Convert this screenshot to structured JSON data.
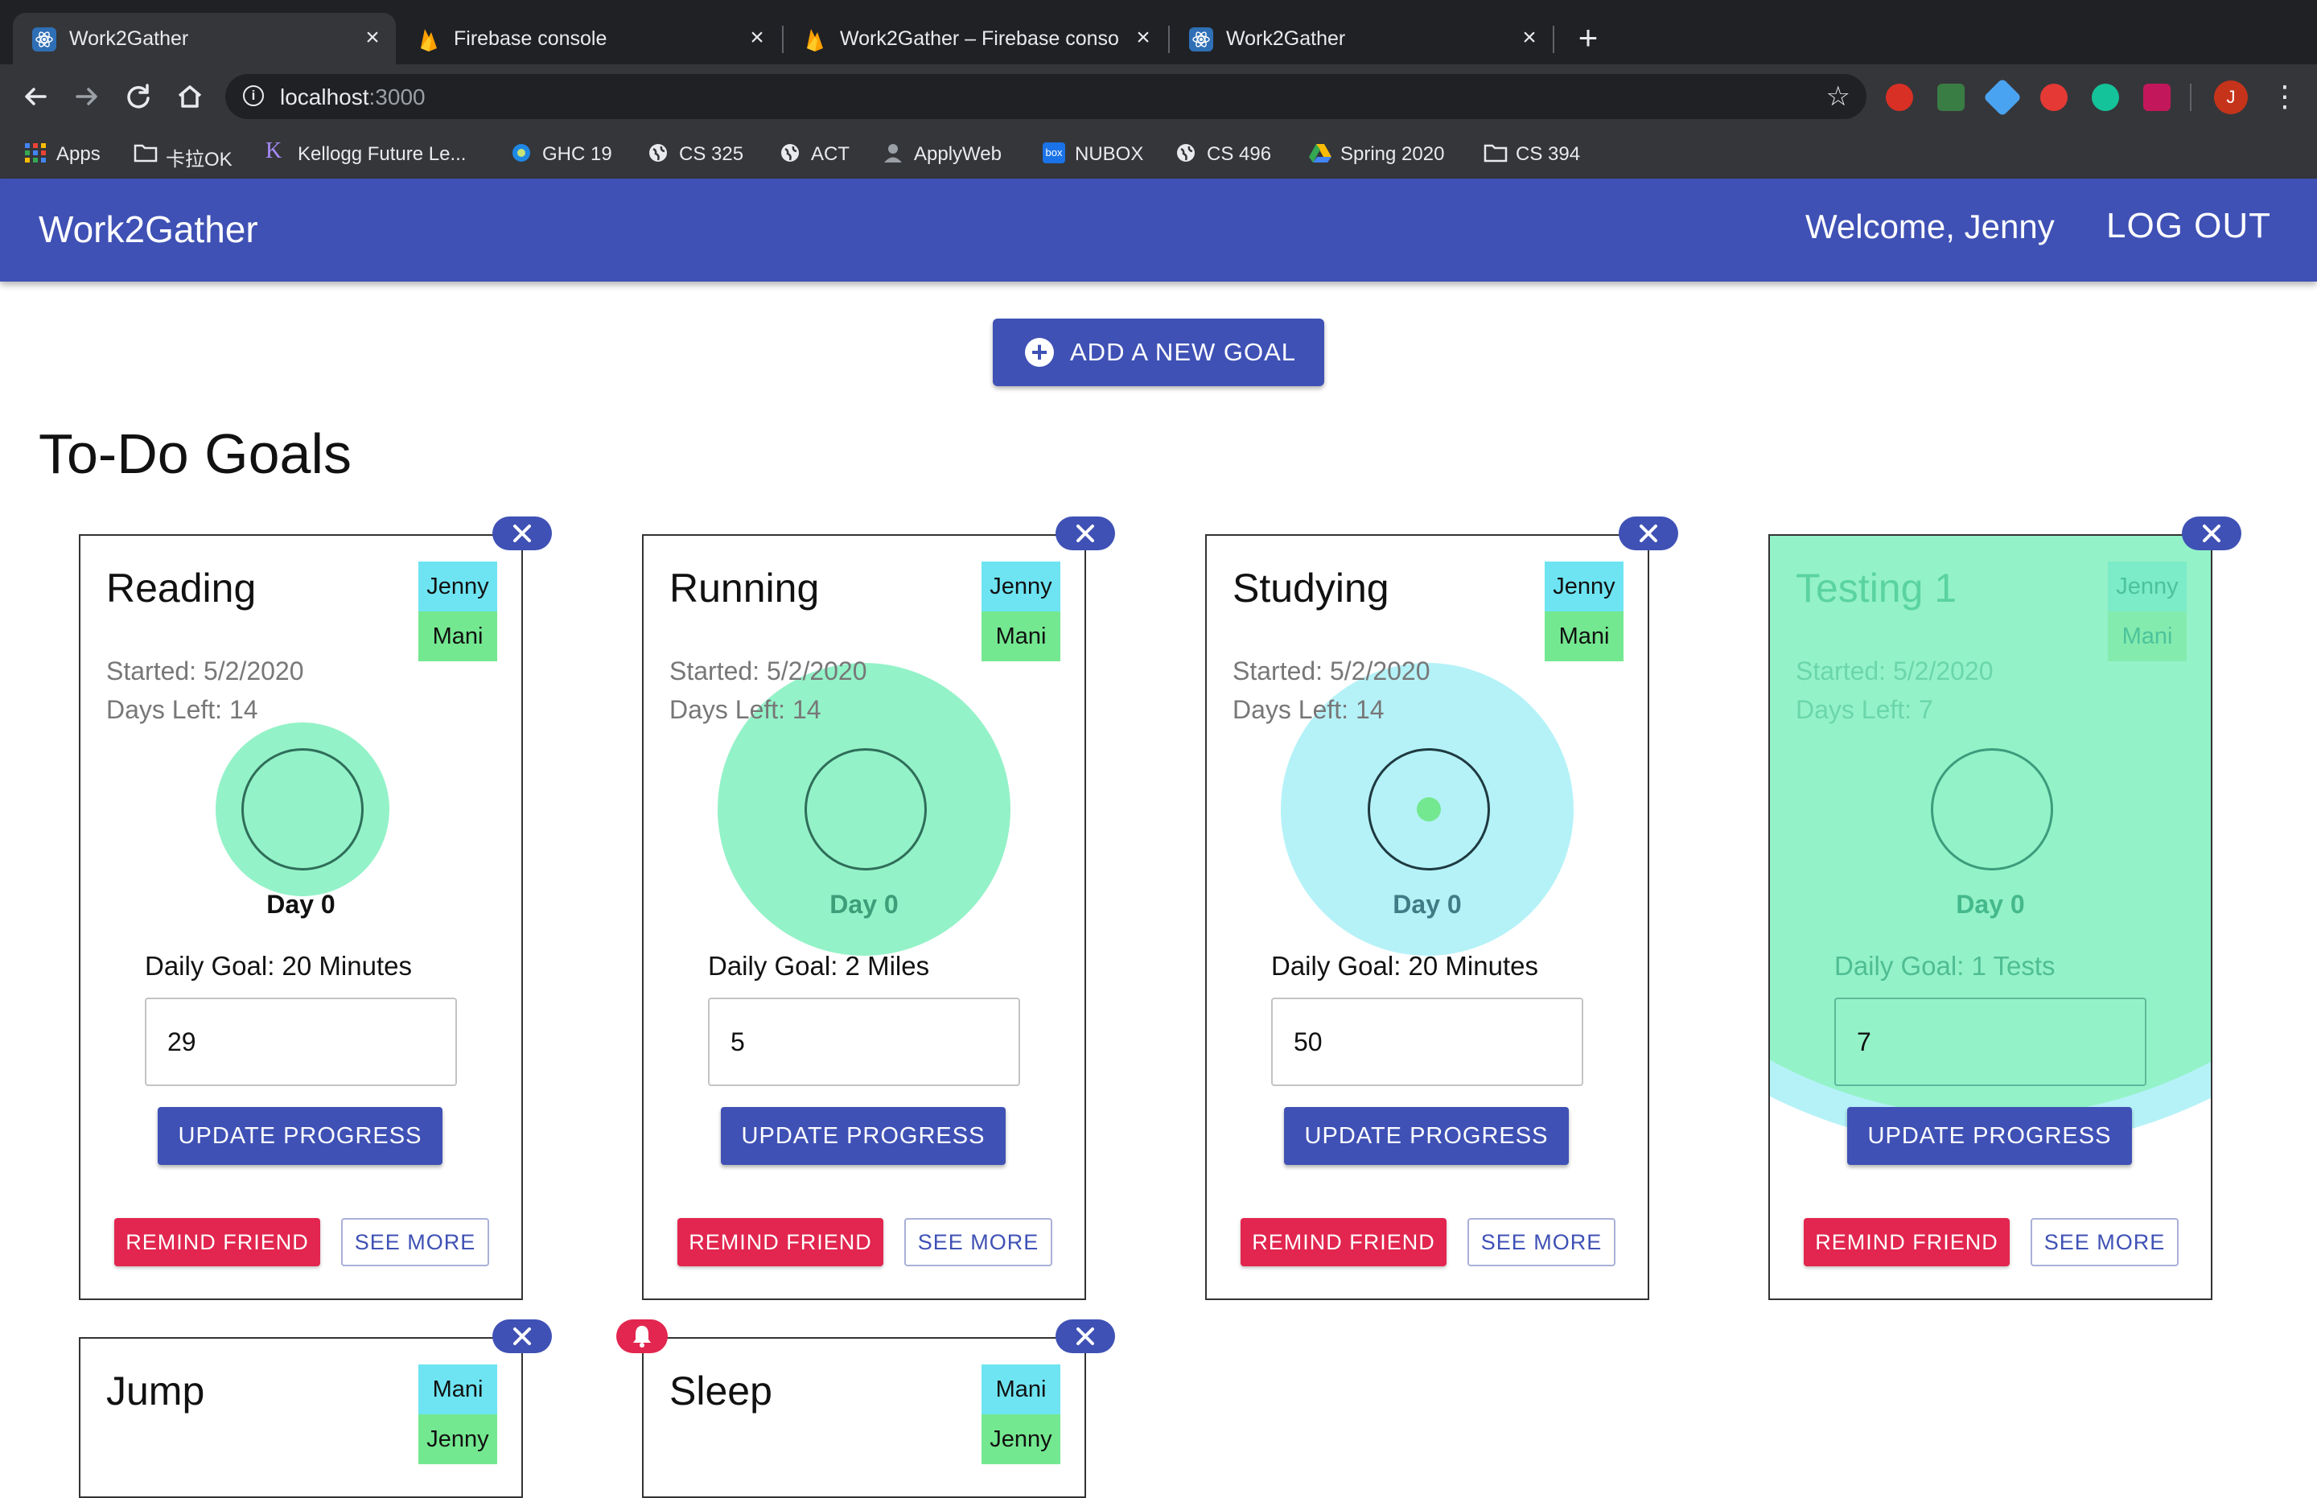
{
  "browser": {
    "tabs": [
      {
        "title": "Work2Gather",
        "favicon": "react-icon"
      },
      {
        "title": "Firebase console",
        "favicon": "firebase-icon"
      },
      {
        "title": "Work2Gather – Firebase conso",
        "favicon": "firebase-icon"
      },
      {
        "title": "Work2Gather",
        "favicon": "react-icon"
      }
    ],
    "url_host": "localhost",
    "url_port": ":3000",
    "bookmarks": [
      "Apps",
      "卡拉OK",
      "Kellogg Future Le...",
      "GHC 19",
      "CS 325",
      "ACT",
      "ApplyWeb",
      "NUBOX",
      "CS 496",
      "Spring 2020",
      "CS 394"
    ],
    "profile_initial": "J"
  },
  "app": {
    "brand": "Work2Gather",
    "welcome": "Welcome, Jenny",
    "logout": "LOG OUT",
    "add_goal": "ADD A NEW GOAL",
    "section_title": "To-Do Goals",
    "update_label": "UPDATE PROGRESS",
    "remind_label": "REMIND FRIEND",
    "see_more_label": "SEE MORE"
  },
  "goals": [
    {
      "name": "Reading",
      "members": [
        "Jenny",
        "Mani"
      ],
      "started": "Started: 5/2/2020",
      "days_left": "Days Left: 14",
      "day": "Day 0",
      "daily_goal": "Daily Goal: 20 Minutes",
      "progress_value": "29"
    },
    {
      "name": "Running",
      "members": [
        "Jenny",
        "Mani"
      ],
      "started": "Started: 5/2/2020",
      "days_left": "Days Left: 14",
      "day": "Day 0",
      "daily_goal": "Daily Goal: 2 Miles",
      "progress_value": "5"
    },
    {
      "name": "Studying",
      "members": [
        "Jenny",
        "Mani"
      ],
      "started": "Started: 5/2/2020",
      "days_left": "Days Left: 14",
      "day": "Day 0",
      "daily_goal": "Daily Goal: 20 Minutes",
      "progress_value": "50"
    },
    {
      "name": "Testing 1",
      "members": [
        "Jenny",
        "Mani"
      ],
      "started": "Started: 5/2/2020",
      "days_left": "Days Left: 7",
      "day": "Day 0",
      "daily_goal": "Daily Goal: 1 Tests",
      "progress_value": "7"
    },
    {
      "name": "Jump",
      "members": [
        "Mani",
        "Jenny"
      ]
    },
    {
      "name": "Sleep",
      "members": [
        "Mani",
        "Jenny"
      ]
    }
  ],
  "colors": {
    "primary": "#3f51b5",
    "secondary": "#e2264f",
    "member_chip_1": "#6ee4f2",
    "member_chip_2": "#74e890",
    "ripple_green": "#94f2c8",
    "ripple_cyan": "#b5f2f8"
  }
}
